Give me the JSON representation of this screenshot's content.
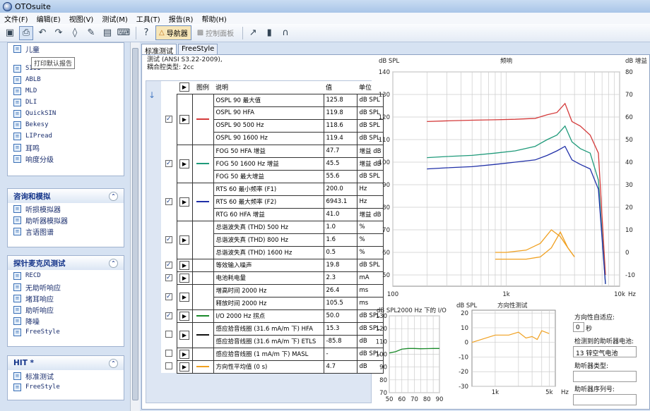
{
  "window": {
    "title": "OTOsuite"
  },
  "menu": [
    "文件(F)",
    "编辑(E)",
    "视图(V)",
    "测试(M)",
    "工具(T)",
    "报告(R)",
    "帮助(H)"
  ],
  "toolbar": {
    "navigator": "导航器",
    "control_panel": "控制面板"
  },
  "tooltip": "打印默认报告",
  "sidebar": {
    "top_items": [
      "儿童",
      "SISI",
      "ABLB",
      "MLD",
      "DLI",
      "QuickSIN",
      "Bekesy",
      "LIPread",
      "耳鸣",
      "响度分级"
    ],
    "sections": [
      {
        "title": "咨询和模拟",
        "items": [
          "听损模拟器",
          "助听器模拟器",
          "言语图谱"
        ]
      },
      {
        "title": "探针麦克风测试",
        "items": [
          "RECD",
          "无助听响应",
          "堵耳响应",
          "助听响应",
          "降噪",
          "FreeStyle"
        ]
      },
      {
        "title": "HIT *",
        "items": [
          "标准测试",
          "FreeStyle"
        ]
      }
    ]
  },
  "tabs": [
    "标准测试",
    "FreeStyle"
  ],
  "info": {
    "line1": "测试 (ANSI S3.22-2009),",
    "line2": "耦合腔类型: 2cc"
  },
  "table": {
    "headers": {
      "legend": "图例",
      "desc": "说明",
      "value": "值",
      "unit": "单位"
    },
    "rows": [
      {
        "desc": "OSPL 90 最大值",
        "value": "125.8",
        "unit": "dB SPL"
      },
      {
        "desc": "OSPL 90 HFA",
        "value": "119.8",
        "unit": "dB SPL"
      },
      {
        "desc": "OSPL 90 500 Hz",
        "value": "118.6",
        "unit": "dB SPL"
      },
      {
        "desc": "OSPL 90 1600 Hz",
        "value": "119.4",
        "unit": "dB SPL"
      },
      {
        "desc": "FOG 50 HFA 增益",
        "value": "47.7",
        "unit": "增益 dB"
      },
      {
        "desc": "FOG 50 1600 Hz 增益",
        "value": "45.5",
        "unit": "增益 dB"
      },
      {
        "desc": "FOG 50 最大增益",
        "value": "55.6",
        "unit": "dB SPL"
      },
      {
        "desc": "RTS 60 最小频率 (F1)",
        "value": "200.0",
        "unit": "Hz"
      },
      {
        "desc": "RTS 60 最大频率 (F2)",
        "value": "6943.1",
        "unit": "Hz"
      },
      {
        "desc": "RTG 60 HFA 增益",
        "value": "41.0",
        "unit": "增益 dB"
      },
      {
        "desc": "总谐波失真 (THD) 500 Hz",
        "value": "1.0",
        "unit": "%"
      },
      {
        "desc": "总谐波失真 (THD) 800 Hz",
        "value": "1.6",
        "unit": "%"
      },
      {
        "desc": "总谐波失真 (THD) 1600 Hz",
        "value": "0.5",
        "unit": "%"
      },
      {
        "desc": "等效输入噪声",
        "value": "19.8",
        "unit": "dB SPL"
      },
      {
        "desc": "电池耗电量",
        "value": "2.3",
        "unit": "mA"
      },
      {
        "desc": "增高时间 2000 Hz",
        "value": "26.4",
        "unit": "ms"
      },
      {
        "desc": "释放时间 2000 Hz",
        "value": "105.5",
        "unit": "ms"
      },
      {
        "desc": "I/O 2000 Hz 拐点",
        "value": "50.0",
        "unit": "dB SPL"
      },
      {
        "desc": "感应拾音线圈 (31.6 mA/m 下) HFA",
        "value": "15.3",
        "unit": "dB SPL"
      },
      {
        "desc": "感应拾音线圈 (31.6 mA/m 下) ETLS",
        "value": "-85.8",
        "unit": "dB"
      },
      {
        "desc": "感应拾音线圈 (1 mA/m 下) MASL",
        "value": "-",
        "unit": "dB SPL"
      },
      {
        "desc": "方向性平均值 (0 s)",
        "value": "4.7",
        "unit": "dB"
      }
    ]
  },
  "colors": {
    "red": "#d43a3a",
    "green": "#1f9a7a",
    "blue": "#2030a8",
    "orange": "#f0a020",
    "black": "#111111",
    "darkgreen": "#1a8a2a"
  },
  "main_chart": {
    "title": "频响",
    "left_label": "dB SPL",
    "right_label": "dB 增益",
    "xunit": "Hz"
  },
  "io_chart": {
    "title": "dB SPL2000 Hz 下的 I/O"
  },
  "dir_chart": {
    "title": "方向性测试",
    "label": "dB SPL"
  },
  "right_fields": {
    "adaptive_label": "方向性自适应:",
    "adaptive_value": "0",
    "adaptive_unit": "秒",
    "battery_label": "检测到的助听器电池:",
    "battery_value": "13 锌空气电池",
    "type_label": "助听器类型:",
    "serial_label": "助听器序列号:"
  },
  "chart_data": [
    {
      "type": "line",
      "title": "频响",
      "xlabel": "Hz",
      "ylabel": "dB SPL",
      "x_scale": "log",
      "xlim": [
        100,
        10000
      ],
      "ylim": [
        45,
        140
      ],
      "x_ticks": [
        "100",
        "1k",
        "10k"
      ],
      "y_ticks": [
        50,
        60,
        70,
        80,
        90,
        100,
        110,
        120,
        130,
        140
      ],
      "right_ticks": [
        -10,
        0,
        10,
        20,
        30,
        40,
        50,
        60,
        70,
        80
      ],
      "series": [
        {
          "color": "red",
          "x": [
            200,
            300,
            500,
            800,
            1200,
            1800,
            2300,
            2800,
            3300,
            3800,
            4500,
            5500,
            6500,
            7500
          ],
          "y": [
            118,
            118.3,
            118.6,
            118.8,
            119,
            119.4,
            121,
            122,
            126,
            118,
            116,
            112,
            104,
            50
          ]
        },
        {
          "color": "green",
          "x": [
            200,
            300,
            500,
            800,
            1200,
            1800,
            2300,
            2800,
            3300,
            3800,
            4500,
            5500,
            6500,
            7500
          ],
          "y": [
            102,
            102.5,
            103,
            104,
            105,
            107,
            110,
            112,
            116,
            109,
            106,
            104,
            92,
            46
          ]
        },
        {
          "color": "blue",
          "x": [
            200,
            300,
            500,
            800,
            1200,
            1800,
            2300,
            2800,
            3300,
            3800,
            4500,
            5500,
            6500,
            7500
          ],
          "y": [
            97,
            97.5,
            98,
            99,
            100,
            101,
            103,
            105,
            107,
            101,
            99,
            97,
            88,
            46
          ]
        },
        {
          "color": "orange",
          "x": [
            800,
            1000,
            1500,
            2000,
            2500,
            3000,
            3500,
            4000
          ],
          "y": [
            60,
            60,
            61,
            64,
            70,
            67,
            62,
            58
          ]
        },
        {
          "color": "orange",
          "x": [
            800,
            1000,
            1500,
            2000,
            2500,
            3000,
            3500,
            4000
          ],
          "y": [
            57,
            57,
            57,
            58,
            62,
            69,
            62,
            58
          ]
        }
      ]
    },
    {
      "type": "line",
      "title": "dB SPL2000 Hz 下的 I/O",
      "xlim": [
        50,
        90
      ],
      "ylim": [
        70,
        130
      ],
      "x_ticks": [
        50,
        60,
        70,
        80,
        90
      ],
      "y_ticks": [
        70,
        80,
        90,
        100,
        110,
        120,
        130
      ],
      "series": [
        {
          "color": "darkgreen",
          "x": [
            50,
            55,
            60,
            65,
            70,
            75,
            80,
            85,
            90
          ],
          "y": [
            101,
            102,
            104,
            104.5,
            104.5,
            104.3,
            104.4,
            104.5,
            104.5
          ]
        }
      ]
    },
    {
      "type": "line",
      "title": "方向性测试",
      "ylabel": "dB SPL",
      "xlim": [
        500,
        6000
      ],
      "ylim": [
        -30,
        22
      ],
      "x_ticks": [
        "1k",
        "5k"
      ],
      "y_ticks": [
        -30,
        -20,
        -10,
        0,
        10,
        20
      ],
      "series": [
        {
          "color": "orange",
          "x": [
            500,
            1000,
            1500,
            2000,
            2500,
            3000,
            3500,
            4000,
            5000
          ],
          "y": [
            0,
            5,
            5,
            7,
            3,
            4,
            2,
            8,
            6
          ]
        }
      ]
    }
  ]
}
